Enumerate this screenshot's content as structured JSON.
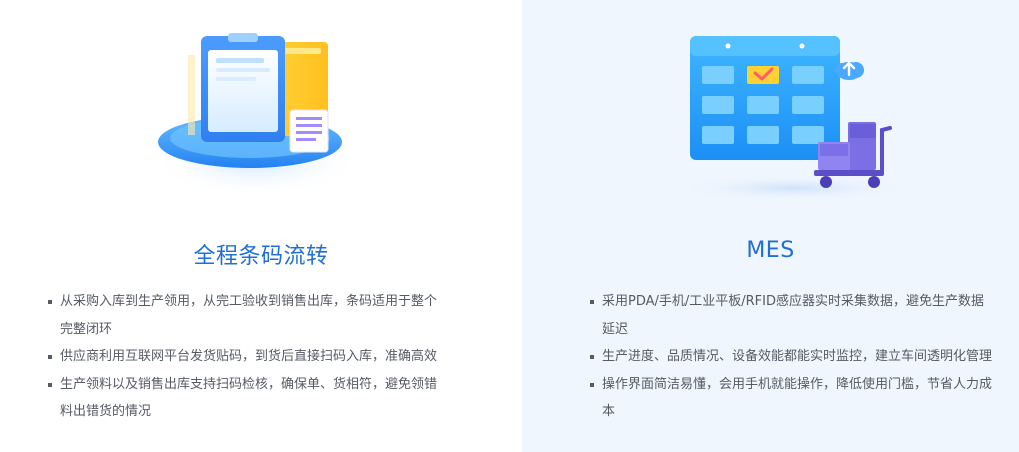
{
  "cards": [
    {
      "title": "全程条码流转",
      "illustration": "clipboard-document-icon",
      "points": [
        "从采购入库到生产领用，从完工验收到销售出库，条码适用于整个完整闭环",
        "供应商利用互联网平台发货贴码，到货后直接扫码入库，准确高效",
        "生产领料以及销售出库支持扫码检核，确保单、货相符，避免领错料出错货的情况"
      ]
    },
    {
      "title": "MES",
      "illustration": "calendar-cart-icon",
      "points": [
        "采用PDA/手机/工业平板/RFID感应器实时采集数据，避免生产数据延迟",
        "生产进度、品质情况、设备效能都能实时监控，建立车间透明化管理",
        "操作界面简洁易懂，会用手机就能操作，降低使用门槛，节省人力成本"
      ]
    }
  ],
  "colors": {
    "title": "#1f6fd6",
    "text": "#555a63",
    "right_panel_bg": "#f0f6fe"
  }
}
